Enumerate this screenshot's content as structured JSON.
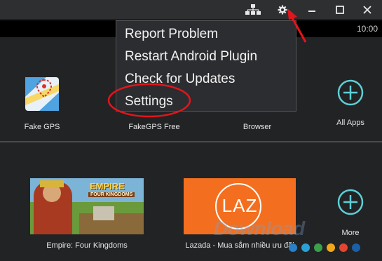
{
  "titlebar": {
    "icons": [
      "network-icon",
      "gear-icon",
      "minimize-icon",
      "maximize-icon",
      "close-icon"
    ]
  },
  "status": {
    "time": "10:00"
  },
  "menu": {
    "items": [
      "Report Problem",
      "Restart Android Plugin",
      "Check for Updates",
      "Settings"
    ]
  },
  "apps_row1": [
    {
      "label": "Fake GPS",
      "icon": "map-pin-icon"
    },
    {
      "label": "FakeGPS Free",
      "icon": "fakegps-icon"
    },
    {
      "label": "Browser",
      "icon": "browser-icon"
    },
    {
      "label": "All Apps",
      "icon": "plus-circle-icon"
    }
  ],
  "apps_row2": [
    {
      "label": "Empire: Four Kingdoms",
      "banner": "EMPIRE",
      "banner_sub": "FOUR KINGDOMS"
    },
    {
      "label": "Lazada - Mua sắm nhiều ưu đãi",
      "banner": "LAZ"
    },
    {
      "label": "More",
      "icon": "plus-circle-icon"
    }
  ],
  "watermark": "Download",
  "colors": {
    "accent_teal": "#5ccfd6",
    "lazada_orange": "#f36f1f",
    "annotation_red": "#e3151b",
    "dots": [
      "#2a7fc6",
      "#2aa0d8",
      "#3aa04a",
      "#f0a81a",
      "#e5452f",
      "#1b5fa6"
    ]
  }
}
